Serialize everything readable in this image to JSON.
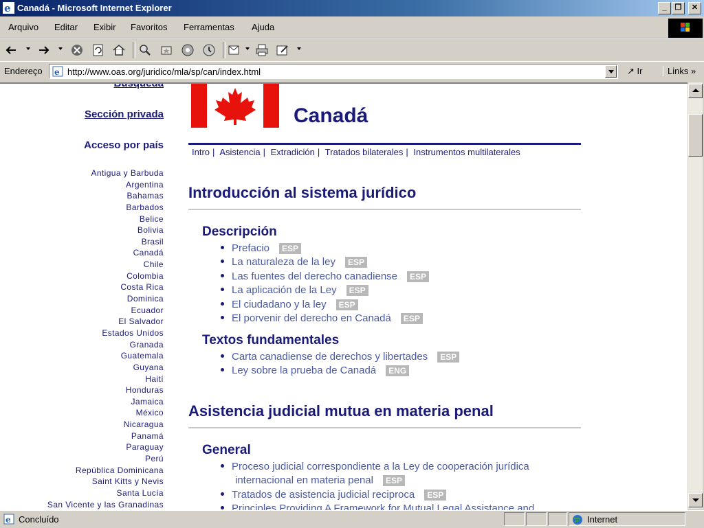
{
  "window": {
    "title": "Canadá - Microsoft Internet Explorer",
    "minimize": "_",
    "maximize": "❐",
    "close": "✕"
  },
  "menu": [
    "Arquivo",
    "Editar",
    "Exibir",
    "Favoritos",
    "Ferramentas",
    "Ajuda"
  ],
  "address": {
    "label": "Endereço",
    "url": "http://www.oas.org/juridico/mla/sp/can/index.html",
    "go_label": "Ir",
    "links_label": "Links"
  },
  "status": {
    "text": "Concluído",
    "zone": "Internet"
  },
  "sidebar": {
    "busqueda": "Búsqueda",
    "seccion_privada": "Sección privada",
    "acceso": "Acceso por país",
    "countries": [
      "Antigua y Barbuda",
      "Argentina",
      "Bahamas",
      "Barbados",
      "Belice",
      "Bolivia",
      "Brasil",
      "Canadá",
      "Chile",
      "Colombia",
      "Costa Rica",
      "Dominica",
      "Ecuador",
      "El Salvador",
      "Estados Unidos",
      "Granada",
      "Guatemala",
      "Guyana",
      "Haití",
      "Honduras",
      "Jamaica",
      "México",
      "Nicaragua",
      "Panamá",
      "Paraguay",
      "Perú",
      "República Dominicana",
      "Saint Kitts y Nevis",
      "Santa Lucía",
      "San Vicente y las Granadinas"
    ]
  },
  "page": {
    "country": "Canadá",
    "tabs": [
      "Intro",
      "Asistencia",
      "Extradición",
      "Tratados bilaterales",
      "Instrumentos multilaterales"
    ],
    "section1": {
      "title": "Introducción al sistema jurídico",
      "descripcion": {
        "title": "Descripción",
        "items": [
          {
            "label": "Prefacio",
            "badge": "ESP"
          },
          {
            "label": "La naturaleza de la ley",
            "badge": "ESP"
          },
          {
            "label": "Las fuentes del derecho canadiense",
            "badge": "ESP"
          },
          {
            "label": "La aplicación de la Ley",
            "badge": "ESP"
          },
          {
            "label": "El ciudadano y la ley",
            "badge": "ESP"
          },
          {
            "label": "El porvenir del derecho en Canadá",
            "badge": "ESP"
          }
        ]
      },
      "textos": {
        "title": "Textos fundamentales",
        "items": [
          {
            "label": "Carta canadiense de derechos y libertades",
            "badge": "ESP"
          },
          {
            "label": "Ley sobre la prueba de Canadá",
            "badge": "ENG"
          }
        ]
      }
    },
    "section2": {
      "title": "Asistencia judicial mutua en materia penal",
      "general": {
        "title": "General",
        "items": [
          {
            "label": "Proceso judicial correspondiente a la Ley de cooperación jurídica",
            "label2": "internacional en materia penal",
            "badge": "ESP"
          },
          {
            "label": "Tratados de asistencia judicial reciproca",
            "badge": "ESP"
          },
          {
            "label": "Principles Providing A Framework for Mutual Legal Assistance and"
          }
        ]
      }
    }
  }
}
